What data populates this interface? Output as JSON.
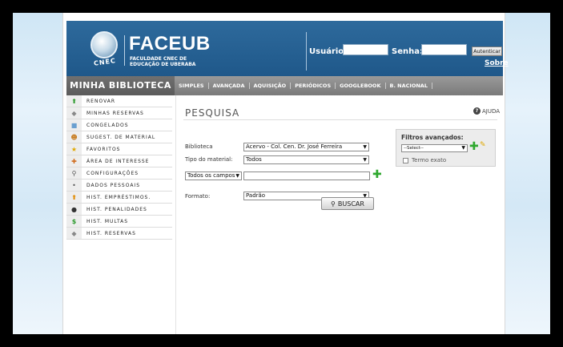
{
  "header": {
    "logo_text": "CNEC",
    "brand": "FACEUB",
    "brand_sub": "FACULDADE CNEC DE EDUCAÇÃO DE UBERABA",
    "usuario_label": "Usuário:",
    "senha_label": "Senha:",
    "usuario_value": "",
    "senha_value": "",
    "auth_button": "Autenticar",
    "sobre": "Sobre"
  },
  "nav": {
    "minha_biblioteca": "MINHA BIBLIOTECA",
    "links": [
      "SIMPLES",
      "AVANÇADA",
      "AQUISIÇÃO",
      "PERIÓDICOS",
      "GOOGLEBOOK",
      "B. NACIONAL"
    ]
  },
  "sidebar": {
    "items": [
      {
        "label": "RENOVAR",
        "icon": "arrow-up-green-icon"
      },
      {
        "label": "MINHAS RESERVAS",
        "icon": "tag-icon"
      },
      {
        "label": "CONGELADOS",
        "icon": "cube-icon"
      },
      {
        "label": "SUGEST. DE MATERIAL",
        "icon": "face-icon"
      },
      {
        "label": "FAVORITOS",
        "icon": "star-icon"
      },
      {
        "label": "ÁREA DE INTERESSE",
        "icon": "puzzle-icon"
      },
      {
        "label": "CONFIGURAÇÕES",
        "icon": "magnifier-icon"
      },
      {
        "label": "DADOS PESSOAIS",
        "icon": "person-icon"
      },
      {
        "label": "HIST. EMPRÉSTIMOS.",
        "icon": "arrow-up-orange-icon"
      },
      {
        "label": "HIST. PENALIDADES",
        "icon": "ball-icon"
      },
      {
        "label": "HIST. MULTAS",
        "icon": "dollar-icon"
      },
      {
        "label": "HIST. RESERVAS",
        "icon": "tag-icon"
      }
    ]
  },
  "main": {
    "title": "PESQUISA",
    "ajuda": "AJUDA",
    "biblioteca_label": "Biblioteca",
    "biblioteca_value": "Acervo - Col. Cen. Dr. José Ferreira",
    "tipo_label": "Tipo do material:",
    "tipo_value": "Todos",
    "campos_value": "Todos os campos",
    "search_value": "",
    "formato_label": "Formato:",
    "formato_value": "Padrão",
    "buscar": "BUSCAR"
  },
  "filtros": {
    "title": "Filtros avançados:",
    "select_value": "--Select--",
    "termo_exato": "Termo exato"
  }
}
